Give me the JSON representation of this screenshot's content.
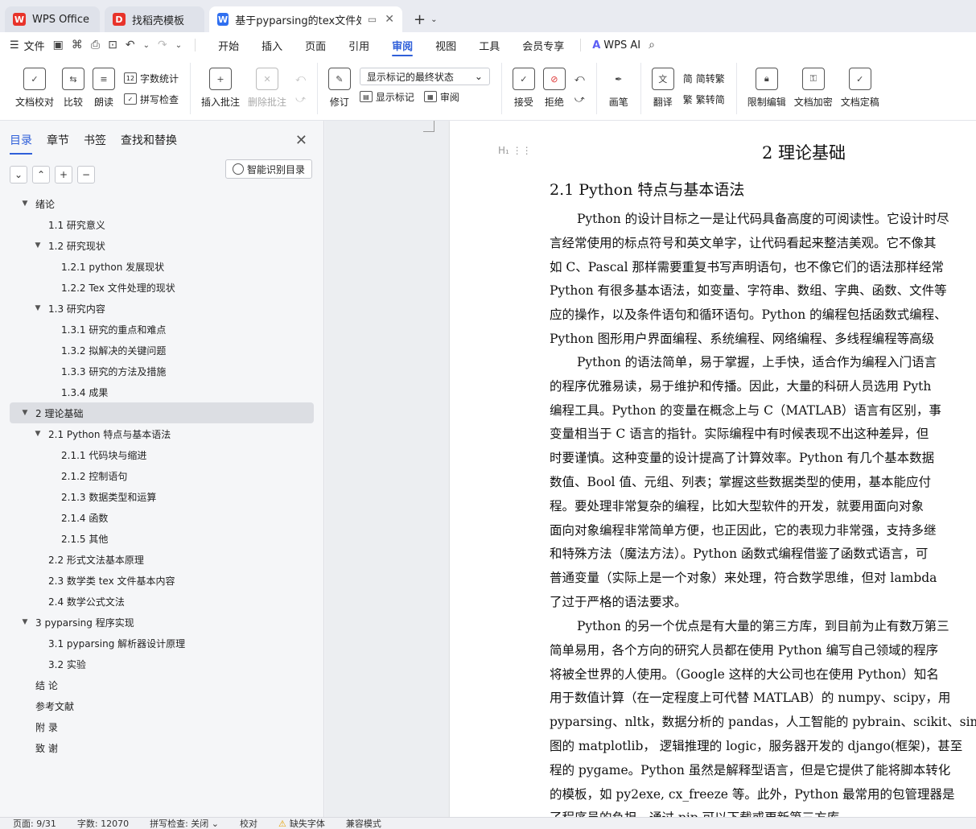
{
  "tabs": [
    {
      "label": "WPS Office",
      "logo": "W",
      "logo_color": "#e8332a"
    },
    {
      "label": "找稻壳模板",
      "logo": "D",
      "logo_color": "#e8332a"
    },
    {
      "label": "基于pyparsing的tex文件处理",
      "logo": "W",
      "logo_color": "#2f6ff0"
    }
  ],
  "menu": {
    "file": "文件",
    "tabs": [
      "开始",
      "插入",
      "页面",
      "引用",
      "审阅",
      "视图",
      "工具",
      "会员专享"
    ],
    "active_tab": "审阅",
    "ai": "WPS AI"
  },
  "ribbon": {
    "doc_proof": "文档校对",
    "compare": "比较",
    "read_aloud": "朗读",
    "word_count": "字数统计",
    "spell_check": "拼写检查",
    "insert_comment": "插入批注",
    "delete_comment": "删除批注",
    "revise": "修订",
    "markup_state": "显示标记的最终状态",
    "show_markup": "显示标记",
    "review": "审阅",
    "accept": "接受",
    "reject": "拒绝",
    "pen": "画笔",
    "translate": "翻译",
    "to_traditional": "简转繁",
    "to_simplified": "繁转简",
    "restrict_edit": "限制编辑",
    "encrypt": "文档加密",
    "finalize": "文档定稿"
  },
  "nav": {
    "tabs": [
      "目录",
      "章节",
      "书签",
      "查找和替换"
    ],
    "active": "目录",
    "smart_toc": "智能识别目录",
    "toc": [
      {
        "label": "绪论",
        "level": 1,
        "arrow": "▼"
      },
      {
        "label": "1.1  研究意义",
        "level": 2,
        "arrow": ""
      },
      {
        "label": "1.2  研究现状",
        "level": 2,
        "arrow": "▼"
      },
      {
        "label": "1.2.1 python 发展现状",
        "level": 3,
        "arrow": ""
      },
      {
        "label": "1.2.2 Tex 文件处理的现状",
        "level": 3,
        "arrow": ""
      },
      {
        "label": "1.3  研究内容",
        "level": 2,
        "arrow": "▼"
      },
      {
        "label": "1.3.1  研究的重点和难点",
        "level": 3,
        "arrow": ""
      },
      {
        "label": "1.3.2  拟解决的关键问题",
        "level": 3,
        "arrow": ""
      },
      {
        "label": "1.3.3  研究的方法及措施",
        "level": 3,
        "arrow": ""
      },
      {
        "label": "1.3.4 成果",
        "level": 3,
        "arrow": ""
      },
      {
        "label": "2  理论基础",
        "level": 1,
        "arrow": "▼",
        "selected": true
      },
      {
        "label": "2.1 Python 特点与基本语法",
        "level": 2,
        "arrow": "▼"
      },
      {
        "label": "2.1.1 代码块与缩进",
        "level": 3,
        "arrow": ""
      },
      {
        "label": "2.1.2 控制语句",
        "level": 3,
        "arrow": ""
      },
      {
        "label": "2.1.3 数据类型和运算",
        "level": 3,
        "arrow": ""
      },
      {
        "label": "2.1.4 函数",
        "level": 3,
        "arrow": ""
      },
      {
        "label": "2.1.5 其他",
        "level": 3,
        "arrow": ""
      },
      {
        "label": "2.2 形式文法基本原理",
        "level": 2,
        "arrow": ""
      },
      {
        "label": "2.3 数学类 tex 文件基本内容",
        "level": 2,
        "arrow": ""
      },
      {
        "label": "2.4  数学公式文法",
        "level": 2,
        "arrow": ""
      },
      {
        "label": "3 pyparsing  程序实现",
        "level": 1,
        "arrow": "▼"
      },
      {
        "label": "3.1 pyparsing 解析器设计原理",
        "level": 2,
        "arrow": ""
      },
      {
        "label": "3.2  实验",
        "level": 2,
        "arrow": ""
      },
      {
        "label": "结  论",
        "level": 1,
        "arrow": ""
      },
      {
        "label": "参考文献",
        "level": 1,
        "arrow": ""
      },
      {
        "label": "附  录",
        "level": 1,
        "arrow": ""
      },
      {
        "label": "致  谢",
        "level": 1,
        "arrow": ""
      }
    ]
  },
  "document": {
    "chapter": "2  理论基础",
    "section": "2.1 Python 特点与基本语法",
    "paragraphs": [
      [
        "Python 的设计目标之一是让代码具备高度的可阅读性。它设计时尽",
        "言经常使用的标点符号和英文单字，让代码看起来整洁美观。它不像其",
        "如 C、Pascal 那样需要重复书写声明语句，也不像它们的语法那样经常",
        "Python 有很多基本语法，如变量、字符串、数组、字典、函数、文件等",
        "应的操作，以及条件语句和循环语句。Python 的编程包括函数式编程、",
        "Python  图形用户界面编程、系统编程、网络编程、多线程编程等高级"
      ],
      [
        "Python 的语法简单，易于掌握，上手快，适合作为编程入门语言",
        "的程序优雅易读，易于维护和传播。因此，大量的科研人员选用 Pyth",
        "编程工具。Python 的变量在概念上与 C（MATLAB）语言有区别，事",
        "变量相当于 C 语言的指针。实际编程中有时候表现不出这种差异，但",
        "时要谨慎。这种变量的设计提高了计算效率。Python 有几个基本数据",
        "数值、Bool 值、元组、列表；掌握这些数据类型的使用，基本能应付",
        "程。要处理非常复杂的编程，比如大型软件的开发，就要用面向对象",
        "面向对象编程非常简单方便，也正因此，它的表现力非常强，支持多继",
        "和特殊方法（魔法方法）。Python  函数式编程借鉴了函数式语言，可",
        "普通变量（实际上是一个对象）来处理，符合数学思维，但对 lambda",
        "了过于严格的语法要求。"
      ],
      [
        "Python 的另一个优点是有大量的第三方库，到目前为止有数万第三",
        "简单易用，各个方向的研究人员都在使用 Python 编写自己领域的程序",
        "将被全世界的人使用。（Google 这样的大公司也在使用 Python）知名",
        "用于数值计算（在一定程度上可代替 MATLAB）的 numpy、scipy，用",
        "pyparsing、nltk，数据分析的 pandas，人工智能的 pybrain、scikit、sim",
        "图的 matplotlib， 逻辑推理的 logic，服务器开发的 django(框架)，甚至",
        "程的 pygame。Python 虽然是解释型语言，但是它提供了能将脚本转化",
        "的模板，如 py2exe, cx_freeze 等。此外，Python 最常用的包管理器是",
        "了程序员的负担。通过 pip 可以下载或更新第三方库"
      ]
    ]
  },
  "status": {
    "page": "页面: 9/31",
    "words": "字数: 12070",
    "spell": "拼写检查: 关闭",
    "proof": "校对",
    "missing_font": "缺失字体",
    "compat": "兼容模式"
  },
  "colors": {
    "accent": "#2f5fd9",
    "warn": "#e6a100"
  }
}
